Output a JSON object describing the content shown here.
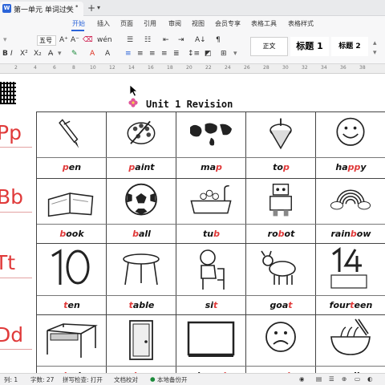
{
  "titlebar": {
    "tab_title": "第一单元 单词过关",
    "app_letter": "W"
  },
  "menu": {
    "items": [
      "开始",
      "插入",
      "页面",
      "引用",
      "审阅",
      "视图",
      "会员专享",
      "表格工具",
      "表格样式"
    ],
    "active": "开始"
  },
  "toolbar": {
    "font_size": "五号",
    "styles": [
      "正文",
      "标题 1",
      "标题 2"
    ]
  },
  "ruler": {
    "numbers": [
      "2",
      "4",
      "6",
      "8",
      "10",
      "12",
      "14",
      "16",
      "18",
      "20",
      "22",
      "24",
      "26",
      "28",
      "30",
      "32",
      "34",
      "36",
      "38"
    ]
  },
  "document": {
    "title": "Unit  1  Revision",
    "rows": [
      {
        "letter": "Pp",
        "words": [
          {
            "pre": "",
            "hl": "p",
            "post": "en"
          },
          {
            "pre": "",
            "hl": "p",
            "post": "aint"
          },
          {
            "pre": "ma",
            "hl": "p",
            "post": ""
          },
          {
            "pre": "to",
            "hl": "p",
            "post": ""
          },
          {
            "pre": "ha",
            "hl": "pp",
            "post": "y"
          }
        ]
      },
      {
        "letter": "Bb",
        "words": [
          {
            "pre": "",
            "hl": "b",
            "post": "ook"
          },
          {
            "pre": "",
            "hl": "b",
            "post": "all"
          },
          {
            "pre": "tu",
            "hl": "b",
            "post": ""
          },
          {
            "pre": "ro",
            "hl": "b",
            "post": "ot"
          },
          {
            "pre": "rain",
            "hl": "b",
            "post": "ow"
          }
        ]
      },
      {
        "letter": "Tt",
        "words": [
          {
            "pre": "",
            "hl": "t",
            "post": "en"
          },
          {
            "pre": "",
            "hl": "t",
            "post": "able"
          },
          {
            "pre": "si",
            "hl": "t",
            "post": ""
          },
          {
            "pre": "goa",
            "hl": "t",
            "post": ""
          },
          {
            "pre": "four",
            "hl": "t",
            "post": "een"
          }
        ]
      },
      {
        "letter": "Dd",
        "words": [
          {
            "pre": "",
            "hl": "d",
            "post": "esk"
          },
          {
            "pre": "",
            "hl": "d",
            "post": "oor"
          },
          {
            "pre": "boar",
            "hl": "d",
            "post": ""
          },
          {
            "pre": "sa",
            "hl": "d",
            "post": ""
          },
          {
            "pre": "",
            "hl": "",
            "post": "noodles"
          }
        ]
      }
    ],
    "pictures": [
      [
        "pen-icon",
        "paint-palette-icon",
        "world-map-icon",
        "spinning-top-icon",
        "smiley-face-icon"
      ],
      [
        "open-book-icon",
        "soccer-ball-icon",
        "bathtub-icon",
        "robot-icon",
        "rainbow-icon"
      ],
      [
        "number-ten-icon",
        "table-icon",
        "sitting-boy-icon",
        "goat-icon",
        "number-fourteen-icon"
      ],
      [
        "desk-icon",
        "door-icon",
        "chalkboard-icon",
        "sad-face-icon",
        "noodle-bowl-icon"
      ]
    ]
  },
  "status": {
    "page": "列: 1",
    "words": "字数: 27",
    "spell": "拼写检查: 打开",
    "proof": "文档校对",
    "backup": "本地备份开"
  },
  "colors": {
    "accent": "#2b64d9",
    "letter_red": "#e03a3a",
    "highlight_red": "#e03a3a"
  }
}
